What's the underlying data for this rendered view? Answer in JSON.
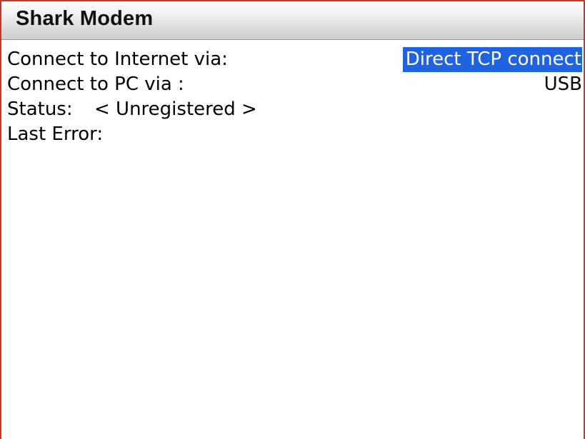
{
  "app": {
    "title": "Shark Modem"
  },
  "fields": {
    "internet": {
      "label": "Connect to Internet via:",
      "value": "Direct TCP connect"
    },
    "pc": {
      "label": "Connect to PC via :",
      "value": "USB"
    },
    "status": {
      "label": "Status:",
      "value": "< Unregistered >"
    },
    "last_error": {
      "label": "Last Error:",
      "value": ""
    }
  },
  "colors": {
    "selection": "#1f63e0",
    "frame_border": "#c0392b"
  }
}
